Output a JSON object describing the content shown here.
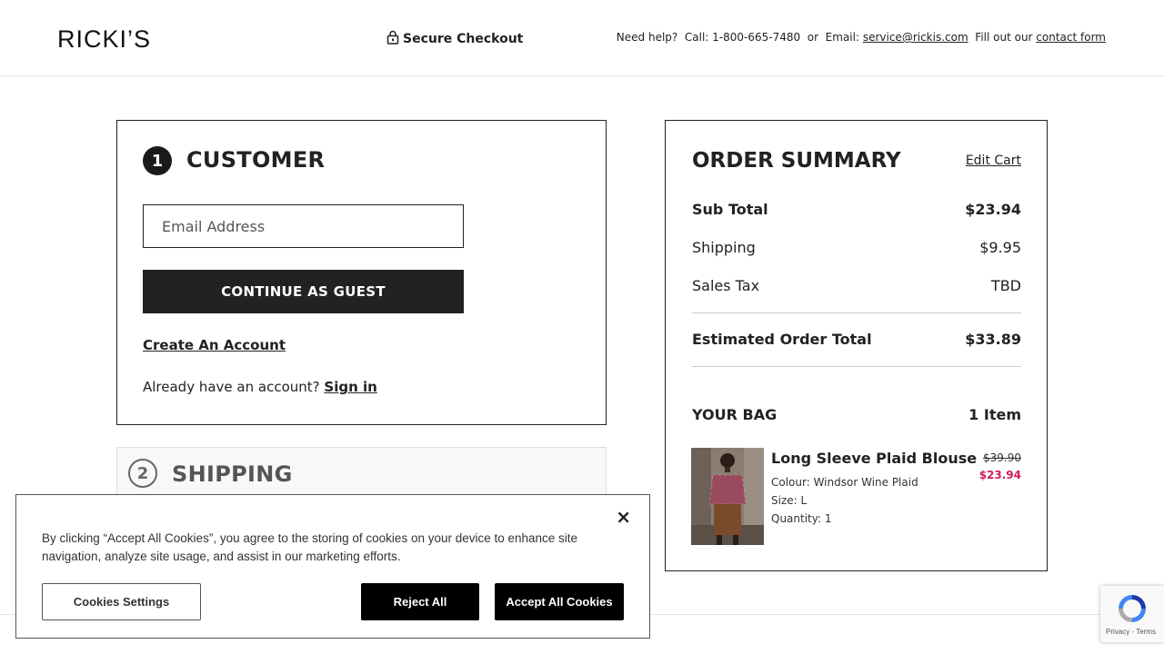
{
  "header": {
    "logo": "RICKI’S",
    "secure_checkout": "Secure Checkout",
    "help_prefix": "Need help?  Call: 1-800-665-7480  or  Email: ",
    "help_email": "service@rickis.com",
    "help_middle": "  Fill out our ",
    "help_contact": "contact form"
  },
  "customer": {
    "step_number": "1",
    "title": "CUSTOMER",
    "email_placeholder": "Email Address",
    "guest_button": "CONTINUE AS GUEST",
    "create_account": "Create An Account",
    "have_account": "Already have an account? ",
    "sign_in": "Sign in"
  },
  "shipping": {
    "step_number": "2",
    "title": "SHIPPING"
  },
  "summary": {
    "title": "ORDER SUMMARY",
    "edit_cart": "Edit Cart",
    "subtotal_label": "Sub Total",
    "subtotal_value": "$23.94",
    "shipping_label": "Shipping",
    "shipping_value": "$9.95",
    "tax_label": "Sales Tax",
    "tax_value": "TBD",
    "total_label": "Estimated Order Total",
    "total_value": "$33.89",
    "bag_label": "YOUR BAG",
    "bag_count": "1 Item",
    "product": {
      "name": "Long Sleeve Plaid Blouse",
      "colour": "Colour: Windsor Wine Plaid",
      "size": "Size: L",
      "quantity": "Quantity: 1",
      "price_old": "$39.90",
      "price_new": "$23.94"
    }
  },
  "cookie": {
    "text": "By clicking “Accept All Cookies”, you agree to the storing of cookies on your device to enhance site navigation, analyze site usage, and assist in our marketing efforts.",
    "settings": "Cookies Settings",
    "reject": "Reject All",
    "accept": "Accept All Cookies",
    "close": "×"
  },
  "recaptcha": {
    "links": "Privacy - Terms"
  },
  "colors": {
    "sale_price": "#d01c5b",
    "primary_dark": "#222222"
  }
}
